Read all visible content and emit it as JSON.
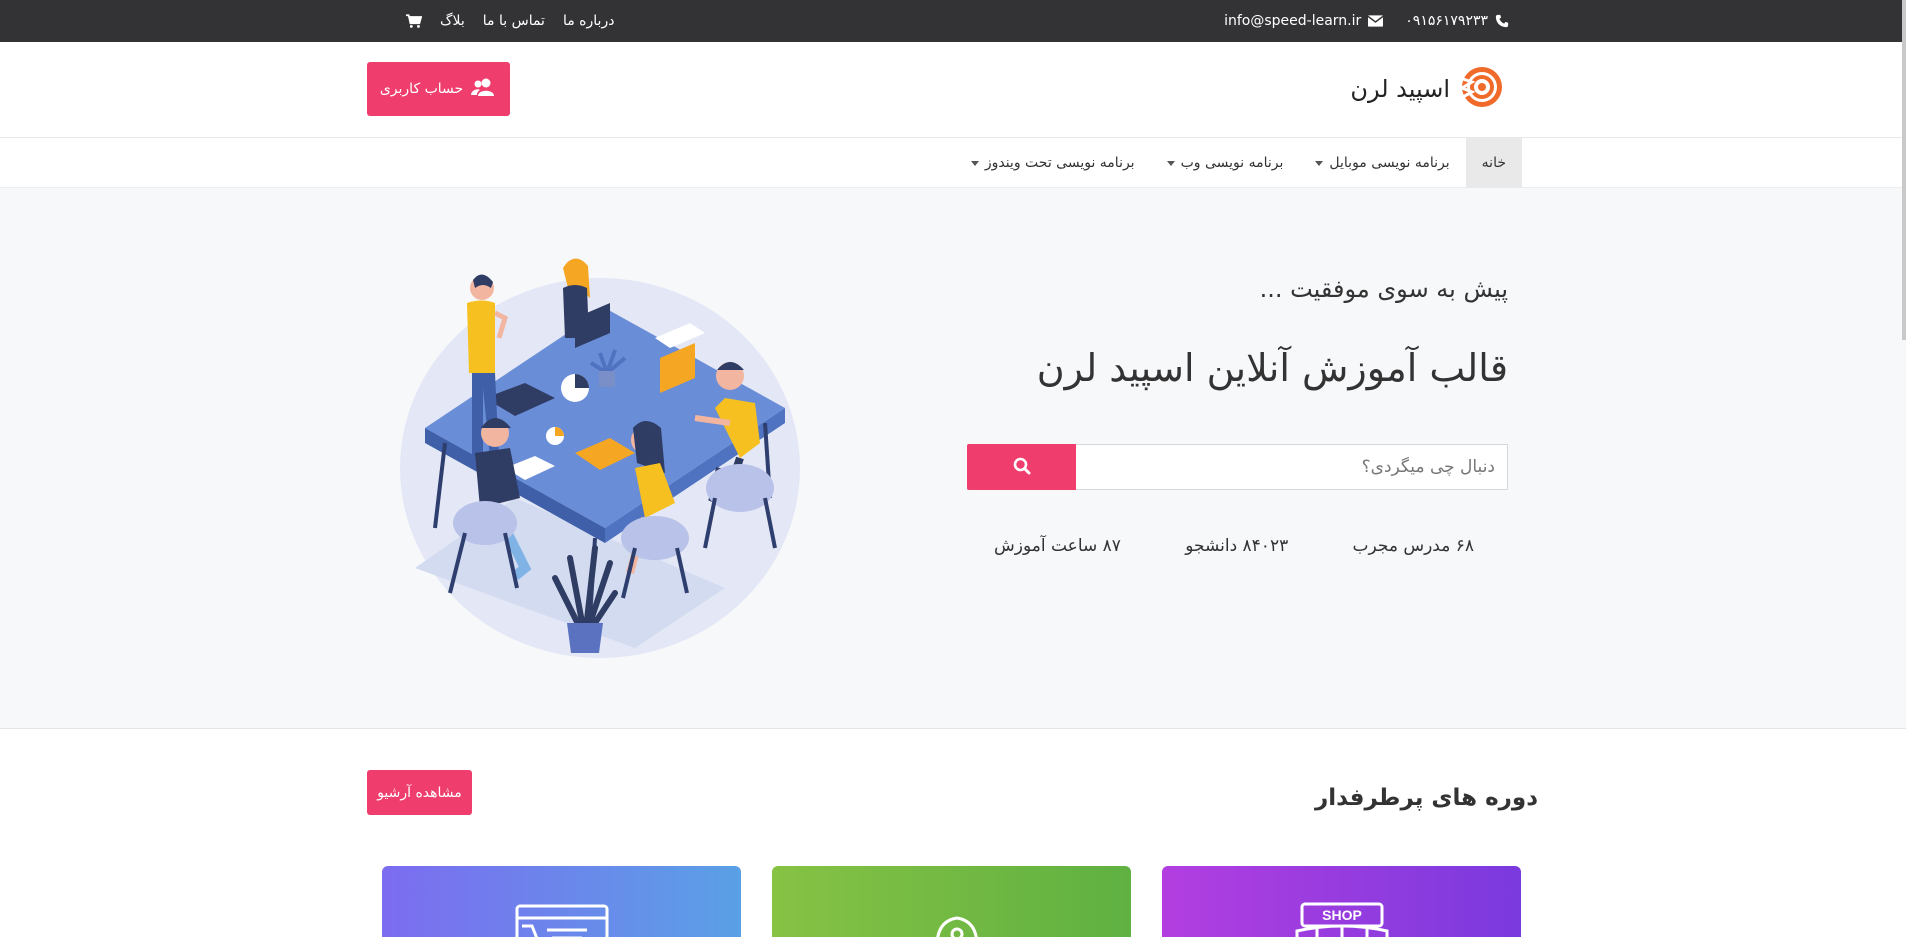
{
  "topbar": {
    "phone": "۰۹۱۵۶۱۷۹۲۳۳",
    "email": "info@speed-learn.ir",
    "links": [
      "درباره ما",
      "تماس با ما",
      "بلاگ"
    ]
  },
  "header": {
    "logo_text": "اسپید لرن",
    "account_button": "حساب کاربری"
  },
  "nav": {
    "items": [
      {
        "label": "خانه",
        "dropdown": false,
        "active": true
      },
      {
        "label": "برنامه نویسی موبایل",
        "dropdown": true,
        "active": false
      },
      {
        "label": "برنامه نویسی وب",
        "dropdown": true,
        "active": false
      },
      {
        "label": "برنامه نویسی تحت ویندوز",
        "dropdown": true,
        "active": false
      }
    ]
  },
  "hero": {
    "tagline": "پیش به سوی موفقیت ...",
    "title": "قالب آموزش آنلاین اسپید لرن",
    "search_placeholder": "دنبال چی میگردی؟",
    "stats": [
      "۶۸ مدرس مجرب",
      "۸۴۰۲۳ دانشجو",
      "۸۷ ساعت آموزش"
    ]
  },
  "popular": {
    "title": "دوره های پرطرفدار",
    "archive_button": "مشاهده آرشیو",
    "cards": [
      {
        "icon": "shop-icon",
        "color": "#9b3ee0"
      },
      {
        "icon": "mouse-icon",
        "color": "#74bb43"
      },
      {
        "icon": "browser-cart-icon",
        "color": "#6b8aec"
      }
    ],
    "shop_sign": "SHOP"
  },
  "colors": {
    "accent": "#ef3e6d",
    "topbar": "#333336",
    "logo_orange": "#f06a2a"
  }
}
